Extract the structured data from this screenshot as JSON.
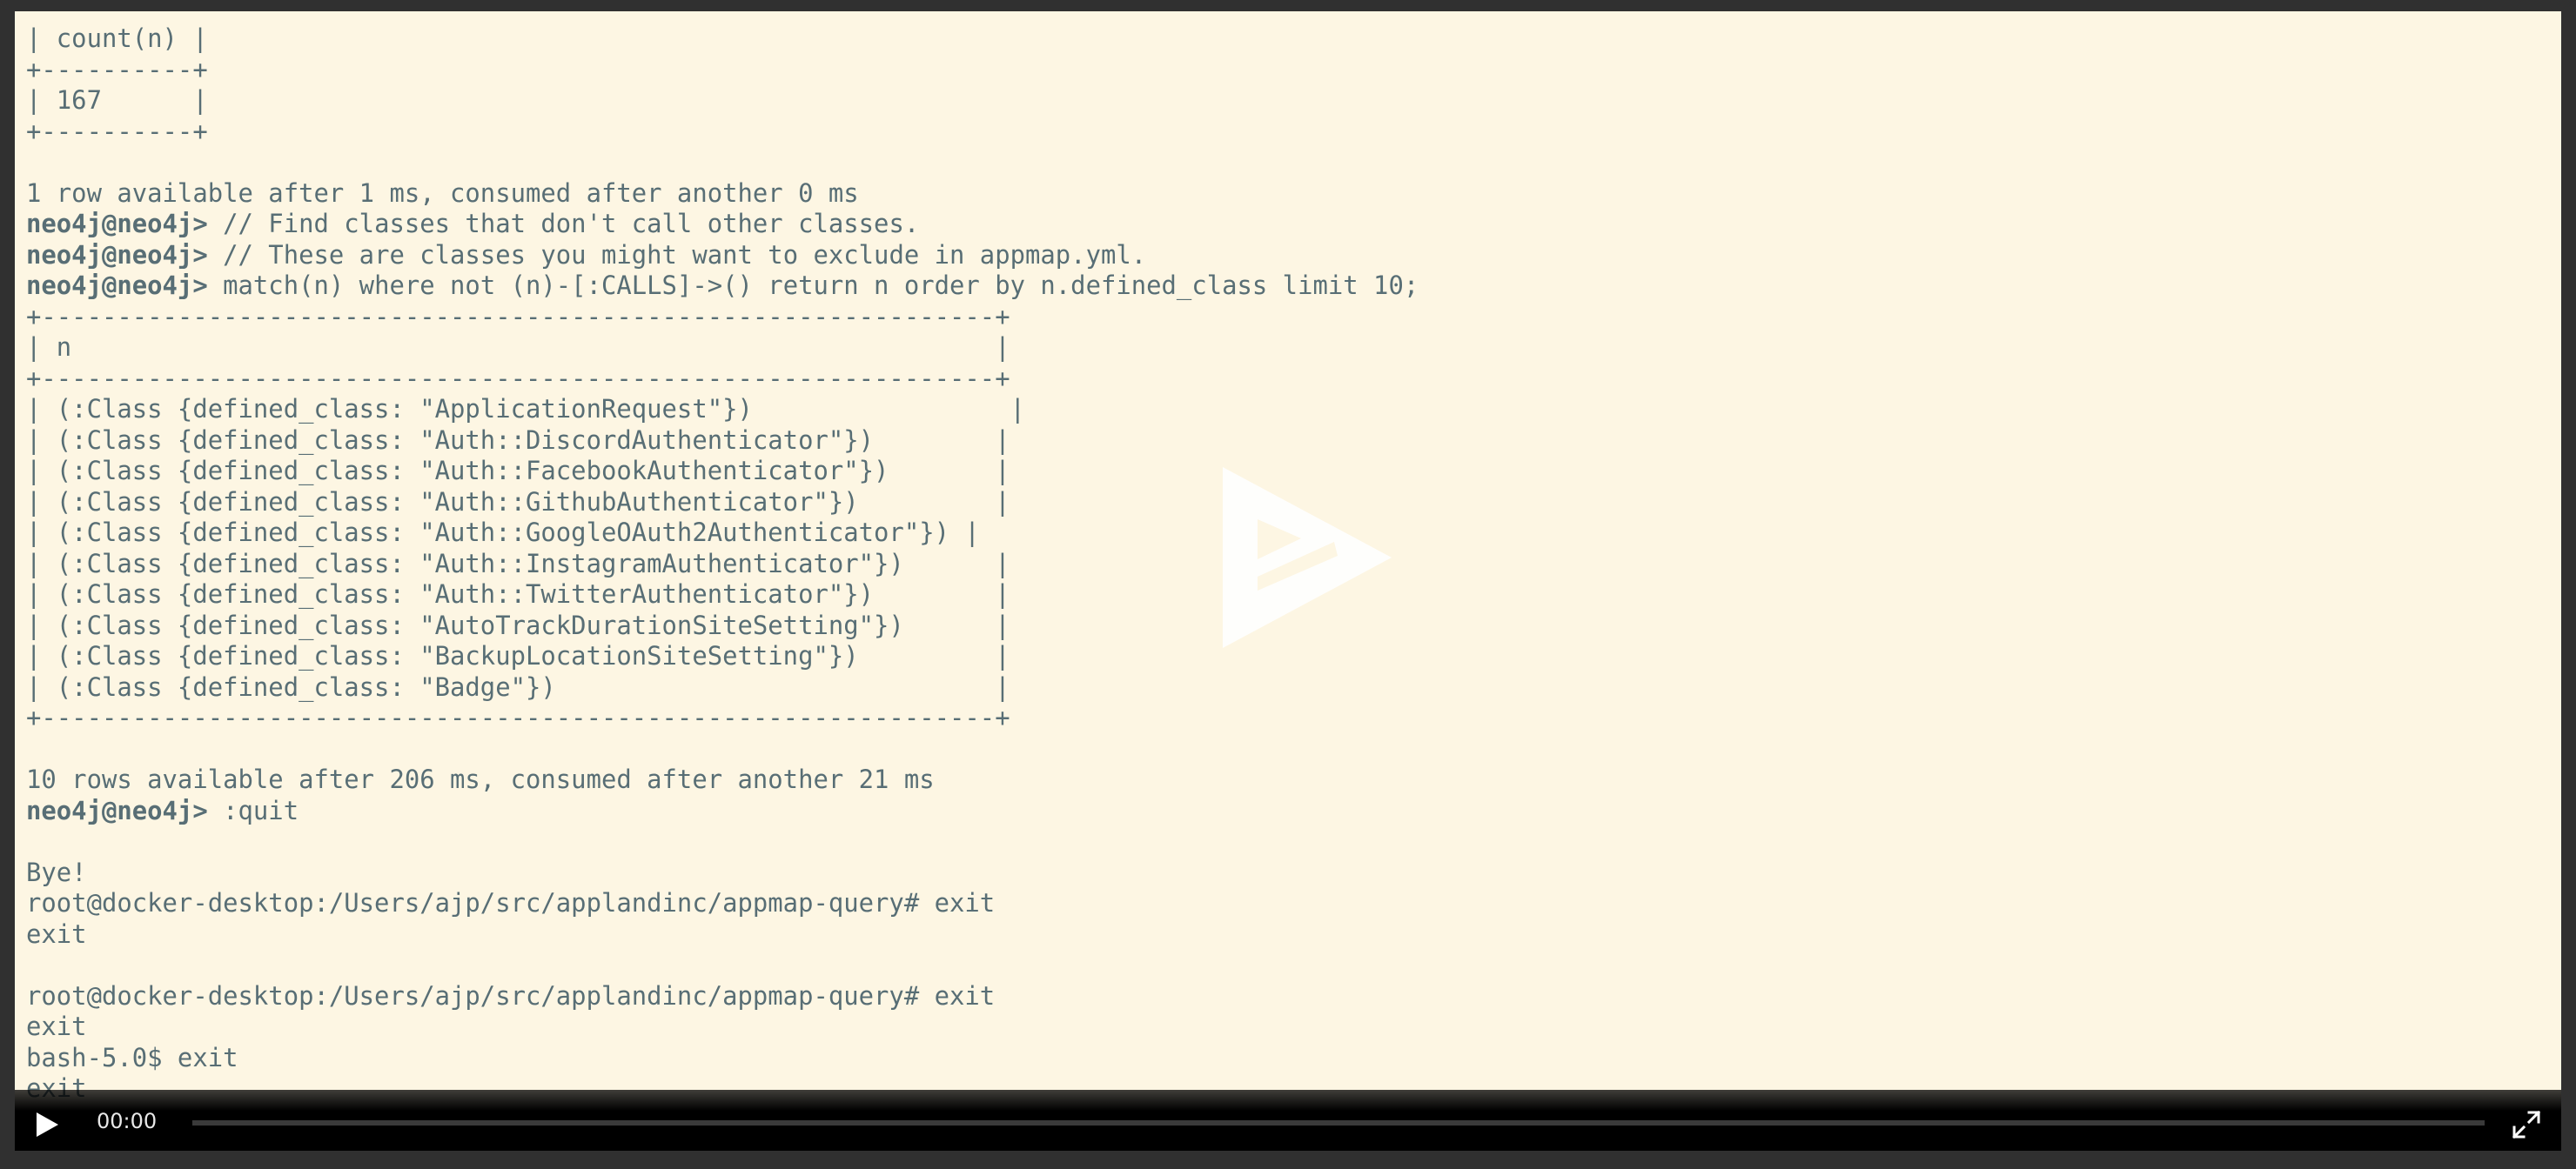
{
  "terminal": {
    "lines": [
      {
        "text": "| count(n) |"
      },
      {
        "text": "+----------+"
      },
      {
        "text": "| 167      |"
      },
      {
        "text": "+----------+"
      },
      {
        "text": ""
      },
      {
        "text": "1 row available after 1 ms, consumed after another 0 ms"
      },
      {
        "prompt": "neo4j@neo4j>",
        "text": " // Find classes that don't call other classes."
      },
      {
        "prompt": "neo4j@neo4j>",
        "text": " // These are classes you might want to exclude in appmap.yml."
      },
      {
        "prompt": "neo4j@neo4j>",
        "text": " match(n) where not (n)-[:CALLS]->() return n order by n.defined_class limit 10;"
      },
      {
        "text": "+---------------------------------------------------------------+"
      },
      {
        "text": "| n                                                             |"
      },
      {
        "text": "+---------------------------------------------------------------+"
      },
      {
        "text": "| (:Class {defined_class: \"ApplicationRequest\"})                 |"
      },
      {
        "text": "| (:Class {defined_class: \"Auth::DiscordAuthenticator\"})        |"
      },
      {
        "text": "| (:Class {defined_class: \"Auth::FacebookAuthenticator\"})       |"
      },
      {
        "text": "| (:Class {defined_class: \"Auth::GithubAuthenticator\"})         |"
      },
      {
        "text": "| (:Class {defined_class: \"Auth::GoogleOAuth2Authenticator\"}) |"
      },
      {
        "text": "| (:Class {defined_class: \"Auth::InstagramAuthenticator\"})      |"
      },
      {
        "text": "| (:Class {defined_class: \"Auth::TwitterAuthenticator\"})        |"
      },
      {
        "text": "| (:Class {defined_class: \"AutoTrackDurationSiteSetting\"})      |"
      },
      {
        "text": "| (:Class {defined_class: \"BackupLocationSiteSetting\"})         |"
      },
      {
        "text": "| (:Class {defined_class: \"Badge\"})                             |"
      },
      {
        "text": "+---------------------------------------------------------------+"
      },
      {
        "text": ""
      },
      {
        "text": "10 rows available after 206 ms, consumed after another 21 ms"
      },
      {
        "prompt": "neo4j@neo4j>",
        "text": " :quit"
      },
      {
        "text": ""
      },
      {
        "text": "Bye!"
      },
      {
        "text": "root@docker-desktop:/Users/ajp/src/applandinc/appmap-query# exit"
      },
      {
        "text": "exit"
      },
      {
        "text": ""
      },
      {
        "text": "root@docker-desktop:/Users/ajp/src/applandinc/appmap-query# exit"
      },
      {
        "text": "exit"
      },
      {
        "text": "bash-5.0$ exit"
      },
      {
        "text": "exit"
      }
    ]
  },
  "player": {
    "time": "00:00",
    "progress": 0,
    "play_icon": "play-icon",
    "fullscreen_icon": "fullscreen-icon",
    "overlay_icon": "big-play-logo-icon"
  },
  "colors": {
    "terminal_background": "#fdf6e3",
    "terminal_text": "#586e75",
    "controlbar_background": "#000000",
    "progress_track": "#3a3a3a"
  }
}
